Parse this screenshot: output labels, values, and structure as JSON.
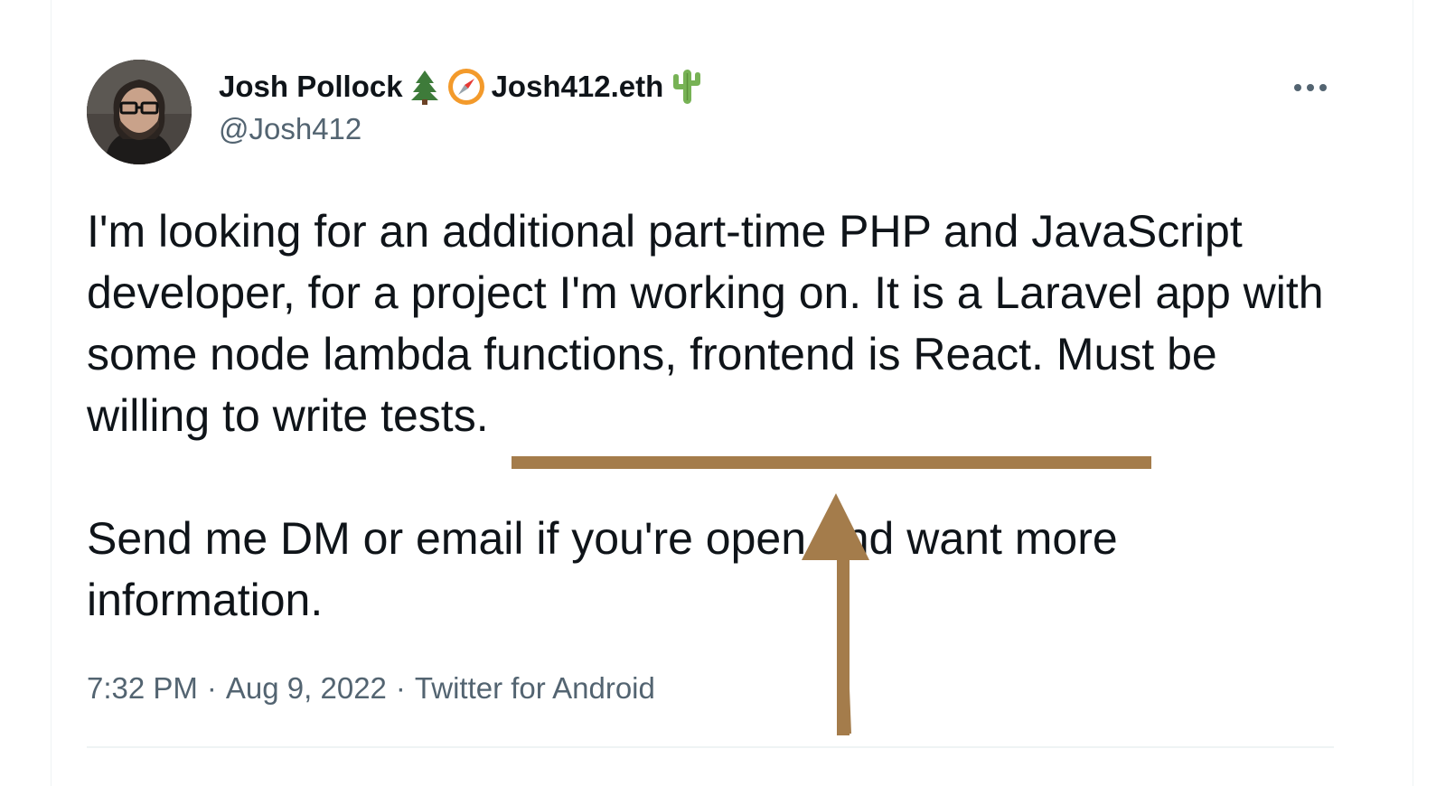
{
  "author": {
    "display_name": "Josh Pollock",
    "ens_name": "Josh412.eth",
    "handle": "@Josh412",
    "name_emojis": [
      "evergreen-tree",
      "compass",
      "cactus"
    ]
  },
  "tweet": {
    "paragraph1_lead": "I'm looking for an additional part-time PHP and JavaScript developer, for a project I'm working on. It is a Laravel app with some node lambda functions, frontend is React. ",
    "paragraph1_emphasis": "Must be willing to write tests.",
    "paragraph2": "Send me DM or email if you're open and want more information."
  },
  "meta": {
    "time": "7:32 PM",
    "separator": "·",
    "date": "Aug 9, 2022",
    "source": "Twitter for Android"
  },
  "menu": {
    "more_icon": "more-horizontal-icon"
  },
  "colors": {
    "text_primary": "#0f1419",
    "text_secondary": "#536471",
    "annotation": "#a47c4b",
    "border": "#eff3f4"
  }
}
